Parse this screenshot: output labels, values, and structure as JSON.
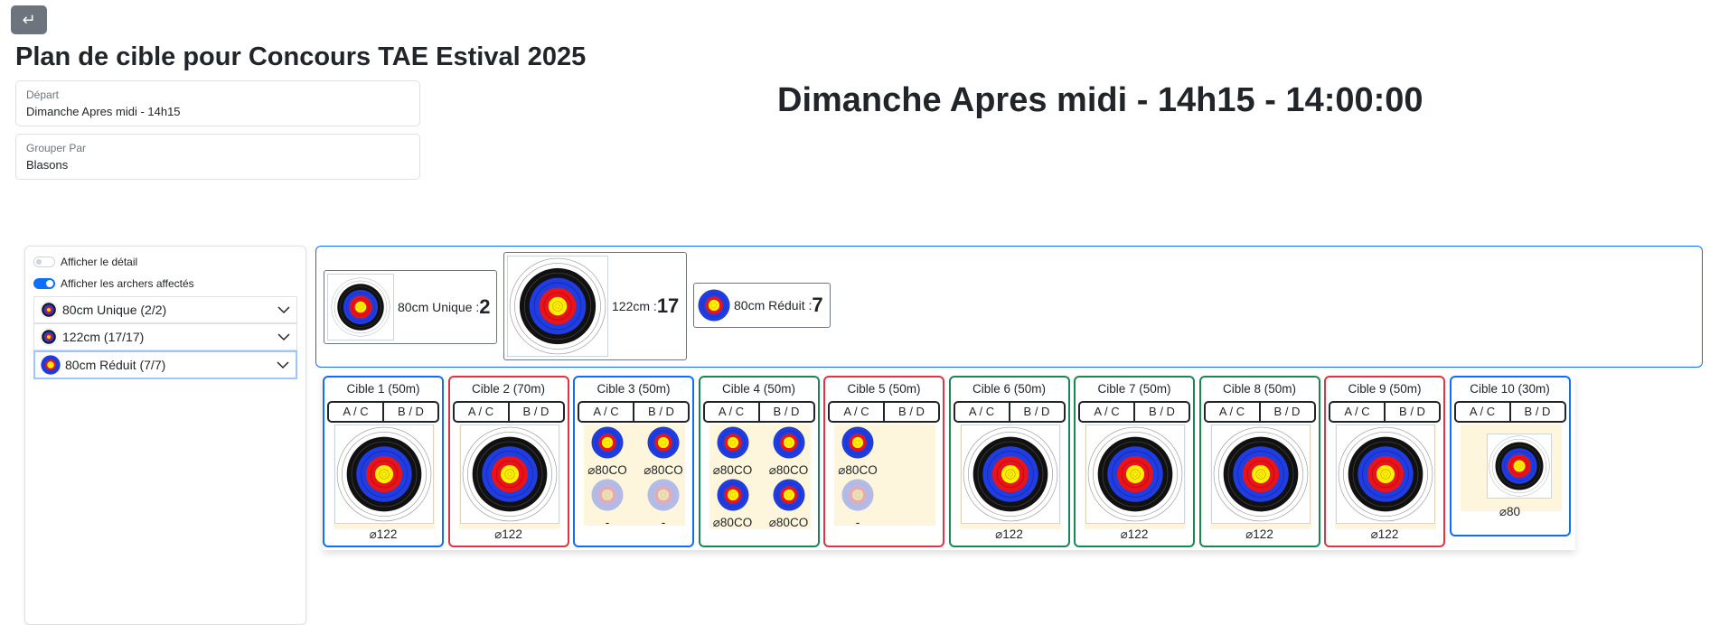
{
  "back_button": {
    "icon": "return-arrow-icon",
    "glyph": "↵"
  },
  "page_title": "Plan de cible pour Concours TAE Estival 2025",
  "depart": {
    "label": "Départ",
    "value": "Dimanche Apres midi - 14h15"
  },
  "grouper": {
    "label": "Grouper Par",
    "value": "Blasons"
  },
  "session_title": "Dimanche Apres midi - 14h15 - 14:00:00",
  "sidebar": {
    "toggles": [
      {
        "label": "Afficher le détail",
        "on": false
      },
      {
        "label": "Afficher les archers affectés",
        "on": true
      }
    ],
    "groups": [
      {
        "label": "80cm Unique (2/2)"
      },
      {
        "label": "122cm (17/17)"
      },
      {
        "label": "80cm Réduit (7/7)"
      }
    ]
  },
  "summary": [
    {
      "label": "80cm Unique : ",
      "count": "2"
    },
    {
      "label": "122cm : ",
      "count": "17"
    },
    {
      "label": "80cm Réduit : ",
      "count": "7"
    }
  ],
  "targets": [
    {
      "title": "Cible 1 (50m)",
      "color": "#0d6efd",
      "pos_ac": "A / C",
      "pos_bd": "B / D",
      "diameter": "⌀122"
    },
    {
      "title": "Cible 2 (70m)",
      "color": "#dc3545",
      "pos_ac": "A / C",
      "pos_bd": "B / D",
      "diameter": "⌀122"
    },
    {
      "title": "Cible 3 (50m)",
      "color": "#0d6efd",
      "pos_ac": "A / C",
      "pos_bd": "B / D",
      "quads": [
        "⌀80CO",
        "⌀80CO",
        "-",
        "-"
      ]
    },
    {
      "title": "Cible 4 (50m)",
      "color": "#198754",
      "pos_ac": "A / C",
      "pos_bd": "B / D",
      "quads": [
        "⌀80CO",
        "⌀80CO",
        "⌀80CO",
        "⌀80CO"
      ]
    },
    {
      "title": "Cible 5 (50m)",
      "color": "#dc3545",
      "pos_ac": "A / C",
      "pos_bd": "B / D",
      "quads": [
        "⌀80CO",
        "",
        "-",
        ""
      ]
    },
    {
      "title": "Cible 6 (50m)",
      "color": "#198754",
      "pos_ac": "A / C",
      "pos_bd": "B / D",
      "diameter": "⌀122"
    },
    {
      "title": "Cible 7 (50m)",
      "color": "#198754",
      "pos_ac": "A / C",
      "pos_bd": "B / D",
      "diameter": "⌀122"
    },
    {
      "title": "Cible 8 (50m)",
      "color": "#198754",
      "pos_ac": "A / C",
      "pos_bd": "B / D",
      "diameter": "⌀122"
    },
    {
      "title": "Cible 9 (50m)",
      "color": "#dc3545",
      "pos_ac": "A / C",
      "pos_bd": "B / D",
      "diameter": "⌀122"
    },
    {
      "title": "Cible 10 (30m)",
      "color": "#0d6efd",
      "pos_ac": "A / C",
      "pos_bd": "B / D",
      "diameter": "⌀80"
    }
  ]
}
